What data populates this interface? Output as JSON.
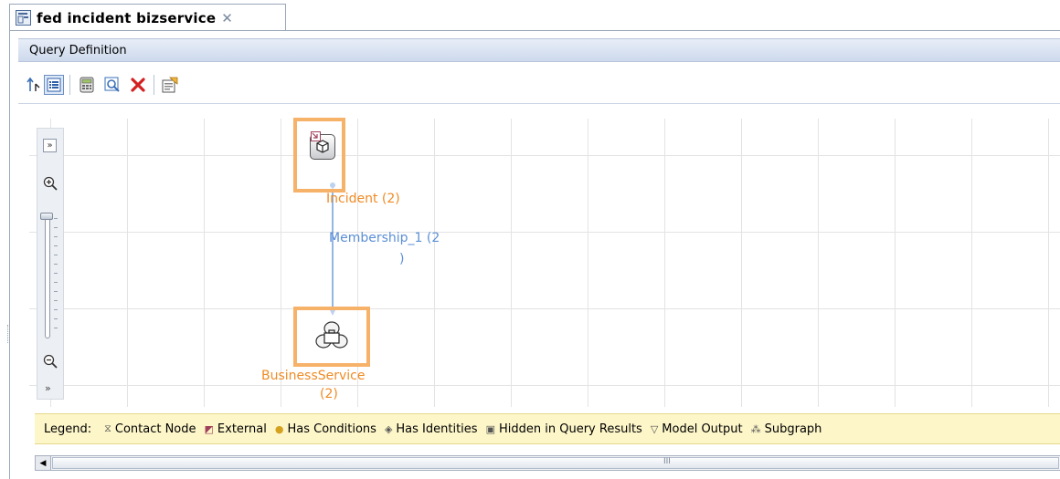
{
  "tab": {
    "title": "fed  incident  bizservice",
    "close_icon": "close-icon"
  },
  "section": {
    "title": "Query Definition"
  },
  "toolbar": {
    "buttons": [
      {
        "name": "layout-icon"
      },
      {
        "name": "list-view-icon"
      },
      {
        "name": "calculator-icon"
      },
      {
        "name": "preview-icon"
      },
      {
        "name": "delete-icon"
      },
      {
        "name": "properties-icon"
      }
    ]
  },
  "zoom": {
    "expand_icon": "double-chevron-right-icon",
    "zoom_in_icon": "zoom-in-icon",
    "zoom_out_icon": "zoom-out-icon",
    "collapse_icon": "double-chevron-down-icon"
  },
  "graph": {
    "node1": {
      "label": "Incident (2)"
    },
    "node2": {
      "label_line1": "BusinessService",
      "label_line2": "(2)"
    },
    "relation": {
      "label_line1": "Membership_1 (2",
      "label_line2": ")"
    },
    "colors": {
      "node_border": "#f7b26a",
      "node_label": "#f08b25",
      "relation": "#5b8fd6"
    }
  },
  "legend": {
    "title": "Legend:",
    "items": [
      {
        "label": "Contact Node",
        "icon": "contact-node-icon"
      },
      {
        "label": "External",
        "icon": "external-icon"
      },
      {
        "label": "Has Conditions",
        "icon": "has-conditions-icon"
      },
      {
        "label": "Has Identities",
        "icon": "has-identities-icon"
      },
      {
        "label": "Hidden in Query Results",
        "icon": "hidden-icon"
      },
      {
        "label": "Model Output",
        "icon": "model-output-icon"
      },
      {
        "label": "Subgraph",
        "icon": "subgraph-icon"
      }
    ]
  },
  "scrollbar": {
    "thumb_grip": "III"
  }
}
